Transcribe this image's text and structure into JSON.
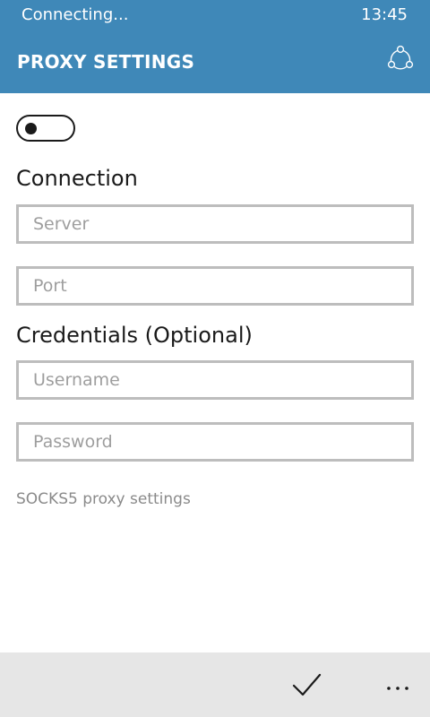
{
  "status_bar": {
    "connection_text": "Connecting...",
    "time": "13:45"
  },
  "header": {
    "title": "PROXY SETTINGS",
    "icon": "share-icon",
    "background_color": "#3f88b8"
  },
  "proxy_toggle": {
    "state": "off"
  },
  "connection": {
    "title": "Connection",
    "server_placeholder": "Server",
    "server_value": "",
    "port_placeholder": "Port",
    "port_value": ""
  },
  "credentials": {
    "title": "Credentials (Optional)",
    "username_placeholder": "Username",
    "username_value": "",
    "password_placeholder": "Password",
    "password_value": ""
  },
  "note": "SOCKS5 proxy settings",
  "app_bar": {
    "confirm_icon": "check-icon",
    "more_icon": "more-dots-icon",
    "background_color": "#e6e6e6"
  }
}
